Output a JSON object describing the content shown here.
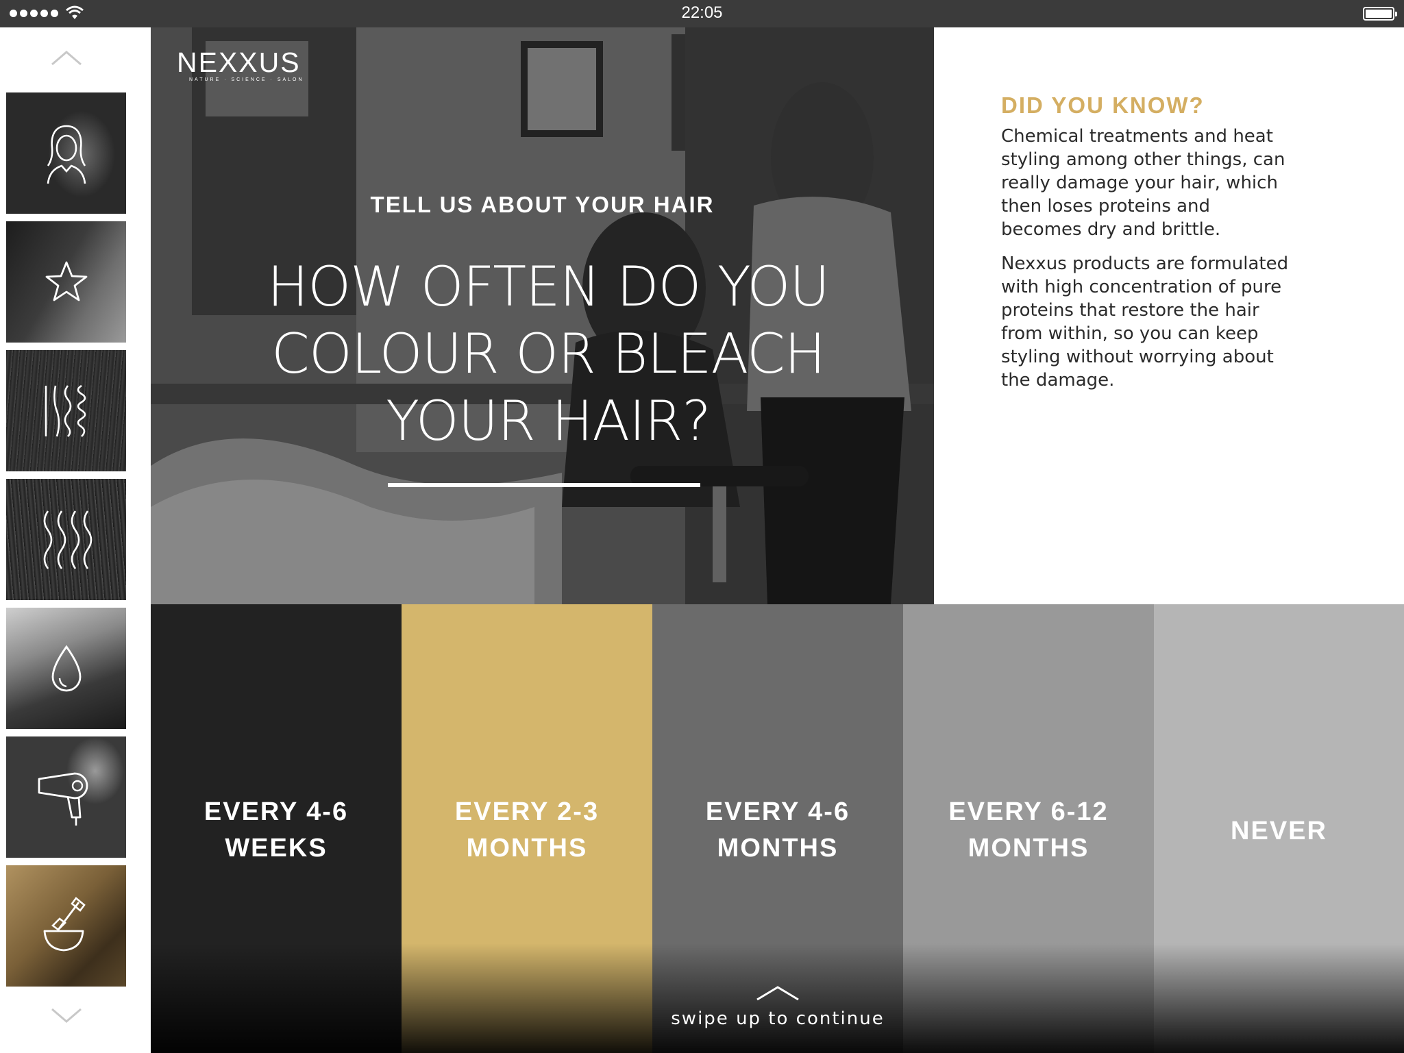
{
  "status_bar": {
    "time": "22:05"
  },
  "brand": {
    "name": "NEXXUS",
    "tagline": "NATURE · SCIENCE · SALON"
  },
  "sidebar": {
    "items": [
      {
        "icon": "woman-head-icon"
      },
      {
        "icon": "star-icon"
      },
      {
        "icon": "hair-types-icon"
      },
      {
        "icon": "wavy-hair-icon"
      },
      {
        "icon": "water-drop-icon"
      },
      {
        "icon": "hair-dryer-icon"
      },
      {
        "icon": "dye-brush-bowl-icon",
        "active": true
      }
    ]
  },
  "hero": {
    "kicker": "TELL US ABOUT YOUR HAIR",
    "question_lines": [
      "HOW OFTEN DO YOU",
      "COLOUR OR BLEACH",
      "YOUR HAIR?"
    ]
  },
  "info": {
    "title": "DID YOU KNOW?",
    "paragraph1": "Chemical treatments and heat styling among other things, can really damage your hair, which then loses proteins and becomes dry and brittle.",
    "paragraph2": "Nexxus products are formulated with high concentration of pure proteins that restore the hair from within, so you can keep styling without worrying about the damage."
  },
  "options": [
    {
      "line1": "EVERY 4-6",
      "line2": "WEEKS",
      "color": "#222222"
    },
    {
      "line1": "EVERY 2-3",
      "line2": "MONTHS",
      "color": "#d4b66c"
    },
    {
      "line1": "EVERY 4-6",
      "line2": "MONTHS",
      "color": "#6b6b6b"
    },
    {
      "line1": "EVERY 6-12",
      "line2": "MONTHS",
      "color": "#999999"
    },
    {
      "line1": "NEVER",
      "line2": "",
      "color": "#b5b5b5"
    }
  ],
  "footer": {
    "swipe_text": "swipe up to continue"
  },
  "colors": {
    "accent_gold": "#d4ae62",
    "status_bar": "#3b3b3b"
  }
}
